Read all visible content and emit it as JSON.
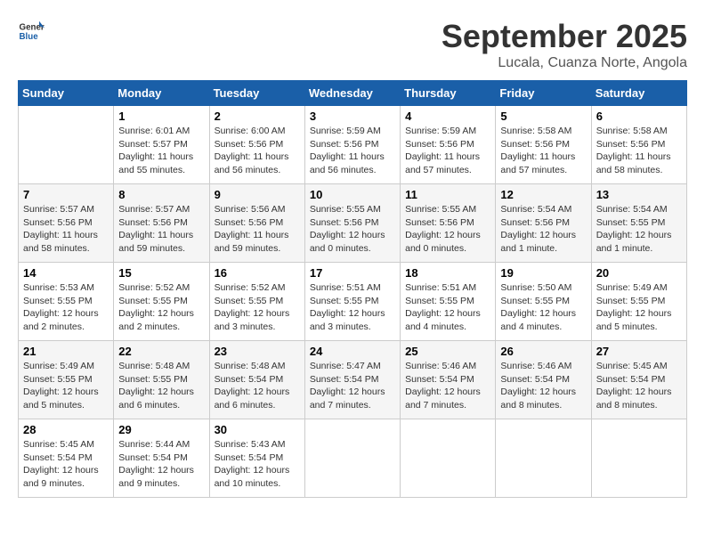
{
  "header": {
    "logo_line1": "General",
    "logo_line2": "Blue",
    "month": "September 2025",
    "location": "Lucala, Cuanza Norte, Angola"
  },
  "days_of_week": [
    "Sunday",
    "Monday",
    "Tuesday",
    "Wednesday",
    "Thursday",
    "Friday",
    "Saturday"
  ],
  "weeks": [
    [
      {
        "day": "",
        "info": ""
      },
      {
        "day": "1",
        "info": "Sunrise: 6:01 AM\nSunset: 5:57 PM\nDaylight: 11 hours and 55 minutes."
      },
      {
        "day": "2",
        "info": "Sunrise: 6:00 AM\nSunset: 5:56 PM\nDaylight: 11 hours and 56 minutes."
      },
      {
        "day": "3",
        "info": "Sunrise: 5:59 AM\nSunset: 5:56 PM\nDaylight: 11 hours and 56 minutes."
      },
      {
        "day": "4",
        "info": "Sunrise: 5:59 AM\nSunset: 5:56 PM\nDaylight: 11 hours and 57 minutes."
      },
      {
        "day": "5",
        "info": "Sunrise: 5:58 AM\nSunset: 5:56 PM\nDaylight: 11 hours and 57 minutes."
      },
      {
        "day": "6",
        "info": "Sunrise: 5:58 AM\nSunset: 5:56 PM\nDaylight: 11 hours and 58 minutes."
      }
    ],
    [
      {
        "day": "7",
        "info": "Sunrise: 5:57 AM\nSunset: 5:56 PM\nDaylight: 11 hours and 58 minutes."
      },
      {
        "day": "8",
        "info": "Sunrise: 5:57 AM\nSunset: 5:56 PM\nDaylight: 11 hours and 59 minutes."
      },
      {
        "day": "9",
        "info": "Sunrise: 5:56 AM\nSunset: 5:56 PM\nDaylight: 11 hours and 59 minutes."
      },
      {
        "day": "10",
        "info": "Sunrise: 5:55 AM\nSunset: 5:56 PM\nDaylight: 12 hours and 0 minutes."
      },
      {
        "day": "11",
        "info": "Sunrise: 5:55 AM\nSunset: 5:56 PM\nDaylight: 12 hours and 0 minutes."
      },
      {
        "day": "12",
        "info": "Sunrise: 5:54 AM\nSunset: 5:56 PM\nDaylight: 12 hours and 1 minute."
      },
      {
        "day": "13",
        "info": "Sunrise: 5:54 AM\nSunset: 5:55 PM\nDaylight: 12 hours and 1 minute."
      }
    ],
    [
      {
        "day": "14",
        "info": "Sunrise: 5:53 AM\nSunset: 5:55 PM\nDaylight: 12 hours and 2 minutes."
      },
      {
        "day": "15",
        "info": "Sunrise: 5:52 AM\nSunset: 5:55 PM\nDaylight: 12 hours and 2 minutes."
      },
      {
        "day": "16",
        "info": "Sunrise: 5:52 AM\nSunset: 5:55 PM\nDaylight: 12 hours and 3 minutes."
      },
      {
        "day": "17",
        "info": "Sunrise: 5:51 AM\nSunset: 5:55 PM\nDaylight: 12 hours and 3 minutes."
      },
      {
        "day": "18",
        "info": "Sunrise: 5:51 AM\nSunset: 5:55 PM\nDaylight: 12 hours and 4 minutes."
      },
      {
        "day": "19",
        "info": "Sunrise: 5:50 AM\nSunset: 5:55 PM\nDaylight: 12 hours and 4 minutes."
      },
      {
        "day": "20",
        "info": "Sunrise: 5:49 AM\nSunset: 5:55 PM\nDaylight: 12 hours and 5 minutes."
      }
    ],
    [
      {
        "day": "21",
        "info": "Sunrise: 5:49 AM\nSunset: 5:55 PM\nDaylight: 12 hours and 5 minutes."
      },
      {
        "day": "22",
        "info": "Sunrise: 5:48 AM\nSunset: 5:55 PM\nDaylight: 12 hours and 6 minutes."
      },
      {
        "day": "23",
        "info": "Sunrise: 5:48 AM\nSunset: 5:54 PM\nDaylight: 12 hours and 6 minutes."
      },
      {
        "day": "24",
        "info": "Sunrise: 5:47 AM\nSunset: 5:54 PM\nDaylight: 12 hours and 7 minutes."
      },
      {
        "day": "25",
        "info": "Sunrise: 5:46 AM\nSunset: 5:54 PM\nDaylight: 12 hours and 7 minutes."
      },
      {
        "day": "26",
        "info": "Sunrise: 5:46 AM\nSunset: 5:54 PM\nDaylight: 12 hours and 8 minutes."
      },
      {
        "day": "27",
        "info": "Sunrise: 5:45 AM\nSunset: 5:54 PM\nDaylight: 12 hours and 8 minutes."
      }
    ],
    [
      {
        "day": "28",
        "info": "Sunrise: 5:45 AM\nSunset: 5:54 PM\nDaylight: 12 hours and 9 minutes."
      },
      {
        "day": "29",
        "info": "Sunrise: 5:44 AM\nSunset: 5:54 PM\nDaylight: 12 hours and 9 minutes."
      },
      {
        "day": "30",
        "info": "Sunrise: 5:43 AM\nSunset: 5:54 PM\nDaylight: 12 hours and 10 minutes."
      },
      {
        "day": "",
        "info": ""
      },
      {
        "day": "",
        "info": ""
      },
      {
        "day": "",
        "info": ""
      },
      {
        "day": "",
        "info": ""
      }
    ]
  ]
}
